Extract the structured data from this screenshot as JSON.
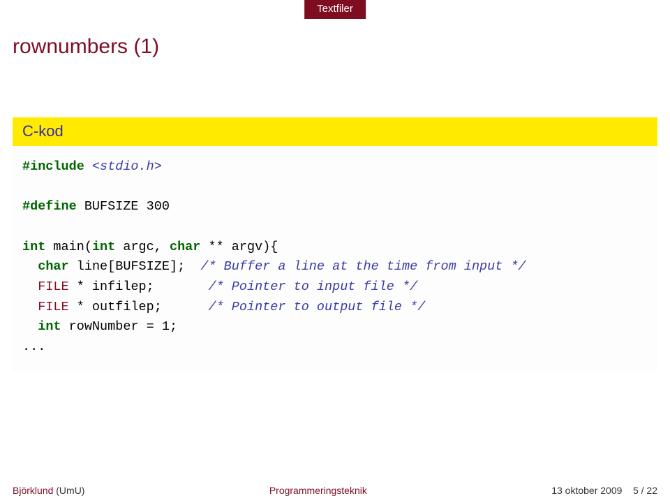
{
  "tab": "Textfiler",
  "title": "rownumbers (1)",
  "block_title": "C-kod",
  "code": {
    "include_open": "#include ",
    "include_hdr": "<stdio.h>",
    "define": "#define",
    "define_rest": " BUFSIZE 300",
    "kw_int": "int",
    "fn_main": " main(",
    "kw_int2": "int",
    "fn_main2": " argc, ",
    "kw_char": "char",
    "fn_main3": " ** argv){",
    "decl_char": "char",
    "decl_line": " line[BUFSIZE];  ",
    "cm_line": "/* Buffer a line at the time from input */",
    "ty_file1": "  FILE",
    "decl_infile": " * infilep;       ",
    "cm_infile": "/* Pointer to input file */",
    "ty_file2": "  FILE",
    "decl_outfile": " * outfilep;      ",
    "cm_outfile": "/* Pointer to output file */",
    "kw_int3": "int",
    "decl_row": " rowNumber = 1;",
    "ellipsis": "..."
  },
  "footer": {
    "author": "Björklund",
    "affiliation": " (UmU)",
    "center": "Programmeringsteknik",
    "date": "13 oktober 2009",
    "page": "5 / 22"
  }
}
